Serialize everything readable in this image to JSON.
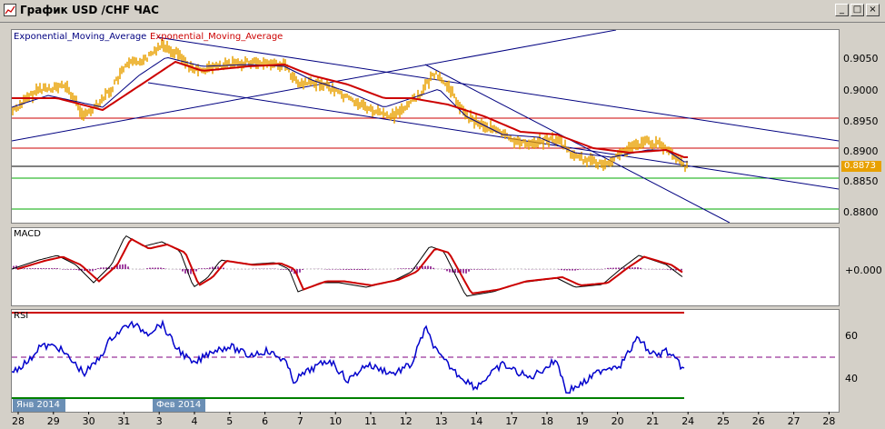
{
  "window": {
    "title": "График USD /CHF ЧАС",
    "buttons": [
      "_",
      "□",
      "×"
    ]
  },
  "price_panel": {
    "indicator_labels": [
      "Exponential_Moving_Average",
      "Exponential_Moving_Average"
    ],
    "current_price": "0.8873",
    "axis_ticks": [
      "0.9050",
      "0.9000",
      "0.8950",
      "0.8900",
      "0.8850",
      "0.8800"
    ]
  },
  "macd_panel": {
    "label": "MACD",
    "axis_tick": "+0.000"
  },
  "rsi_panel": {
    "label": "RSI",
    "axis_ticks": [
      "60",
      "40"
    ]
  },
  "month_labels": [
    "Янв 2014",
    "Фев 2014"
  ],
  "date_ticks": [
    "28",
    "29",
    "30",
    "31",
    "3",
    "4",
    "5",
    "6",
    "7",
    "10",
    "11",
    "12",
    "13",
    "14",
    "17",
    "18",
    "19",
    "20",
    "21",
    "24",
    "25",
    "26",
    "27",
    "28"
  ],
  "colors": {
    "price_bars": "#e8a000",
    "ema_fast": "#000080",
    "ema_slow": "#cc0000",
    "hline_red": "#cc0000",
    "hline_green": "#00aa00",
    "trend": "#000080",
    "macd_line": "#000000",
    "macd_signal": "#cc0000",
    "macd_hist": "#800080",
    "rsi": "#0000cc",
    "rsi_upper": "#cc0000",
    "rsi_lower": "#008000",
    "rsi_mid": "#800080",
    "price_tag": "#e8a000"
  }
}
